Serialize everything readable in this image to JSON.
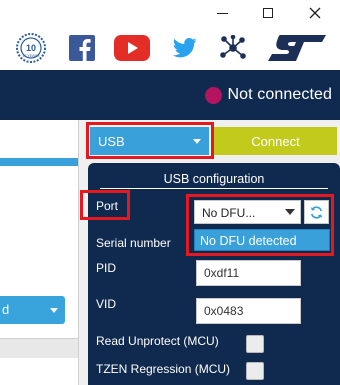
{
  "window_controls": {
    "minimize_icon": "minimize-icon",
    "maximize_icon": "maximize-icon",
    "close_icon": "close-icon"
  },
  "social": {
    "anniversary_icon": "10-years-badge-icon",
    "facebook_icon": "facebook-icon",
    "youtube_icon": "youtube-icon",
    "twitter_icon": "twitter-icon",
    "network_icon": "network-icon",
    "brand_logo": "st-logo-icon",
    "badge_text": "10 YEARS"
  },
  "header": {
    "status_text": "Not connected",
    "status_color": "#b5155f"
  },
  "left_panel": {
    "select_value": "d"
  },
  "connection": {
    "interface_value": "USB",
    "connect_label": "Connect"
  },
  "usb_config": {
    "title": "USB configuration",
    "port_label": "Port",
    "port_value": "No DFU...",
    "port_dropdown_option": "No DFU detected",
    "refresh_icon": "refresh-icon",
    "serial_label": "Serial number",
    "pid_label": "PID",
    "pid_value": "0xdf11",
    "vid_label": "VID",
    "vid_value": "0x0483",
    "read_unprotect_label": "Read Unprotect (MCU)",
    "tzen_label": "TZEN Regression (MCU)"
  },
  "colors": {
    "navy": "#0f2a4e",
    "accent_blue": "#3aa0d9",
    "connect_green": "#c2cb1b",
    "highlight_red": "#e5171f"
  }
}
